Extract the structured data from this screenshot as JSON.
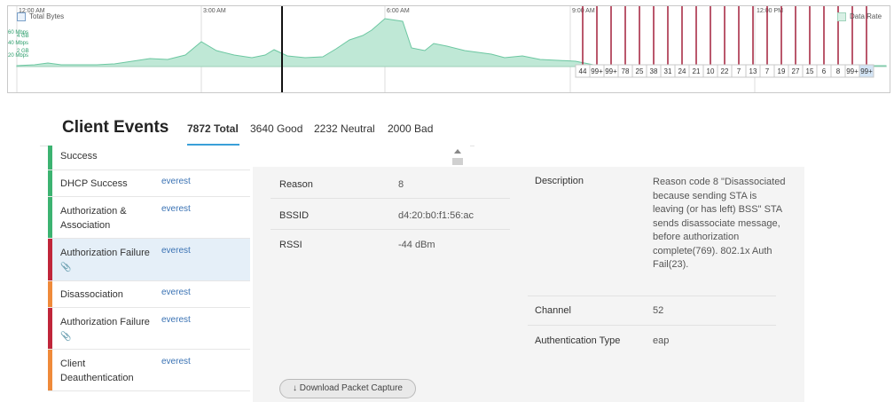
{
  "timeline": {
    "times": [
      "12:00 AM",
      "3:00 AM",
      "6:00 AM",
      "9:00 AM",
      "12:00 PM"
    ],
    "legend_total_bytes": "Total Bytes",
    "legend_data_rate": "Data Rate",
    "left_axis": [
      "60 Mbps",
      "4 GB",
      "40 Mbps",
      "2 GB",
      "20 Mbps"
    ],
    "event_counts": [
      "44",
      "99+",
      "99+",
      "78",
      "25",
      "38",
      "31",
      "24",
      "21",
      "10",
      "22",
      "7",
      "13",
      "7",
      "19",
      "27",
      "15",
      "6",
      "8",
      "99+",
      "99+"
    ],
    "colors": {
      "area_fill": "#bfe8d6",
      "area_line": "#6cc7a1",
      "event_line": "#a3203a",
      "cursor": "#111111"
    }
  },
  "client_events": {
    "title": "Client Events",
    "tabs": {
      "total": "7872 Total",
      "good": "3640 Good",
      "neutral": "2232 Neutral",
      "bad": "2000 Bad"
    },
    "rows": [
      {
        "name": "Success",
        "site": "",
        "color": "#3cb371"
      },
      {
        "name": "DHCP Success",
        "site": "everest",
        "color": "#3cb371"
      },
      {
        "name": "Authorization & Association",
        "site": "everest",
        "color": "#3cb371"
      },
      {
        "name": "Authorization Failure",
        "site": "everest",
        "color": "#c0263a",
        "attachment": true
      },
      {
        "name": "Disassociation",
        "site": "everest",
        "color": "#ef8a3a"
      },
      {
        "name": "Authorization Failure",
        "site": "everest",
        "color": "#c0263a",
        "attachment": true
      },
      {
        "name": "Client Deauthentication",
        "site": "everest",
        "color": "#ef8a3a"
      }
    ]
  },
  "detail": {
    "reason_label": "Reason",
    "reason_value": "8",
    "bssid_label": "BSSID",
    "bssid_value": "d4:20:b0:f1:56:ac",
    "rssi_label": "RSSI",
    "rssi_value": "-44 dBm",
    "description_label": "Description",
    "description_value": "Reason code 8 \"Disassociated because sending STA is leaving (or has left) BSS\" STA sends disassociate message, before authorization complete(769). 802.1x Auth Fail(23).",
    "channel_label": "Channel",
    "channel_value": "52",
    "auth_type_label": "Authentication Type",
    "auth_type_value": "eap",
    "download_label": "Download Packet Capture"
  }
}
